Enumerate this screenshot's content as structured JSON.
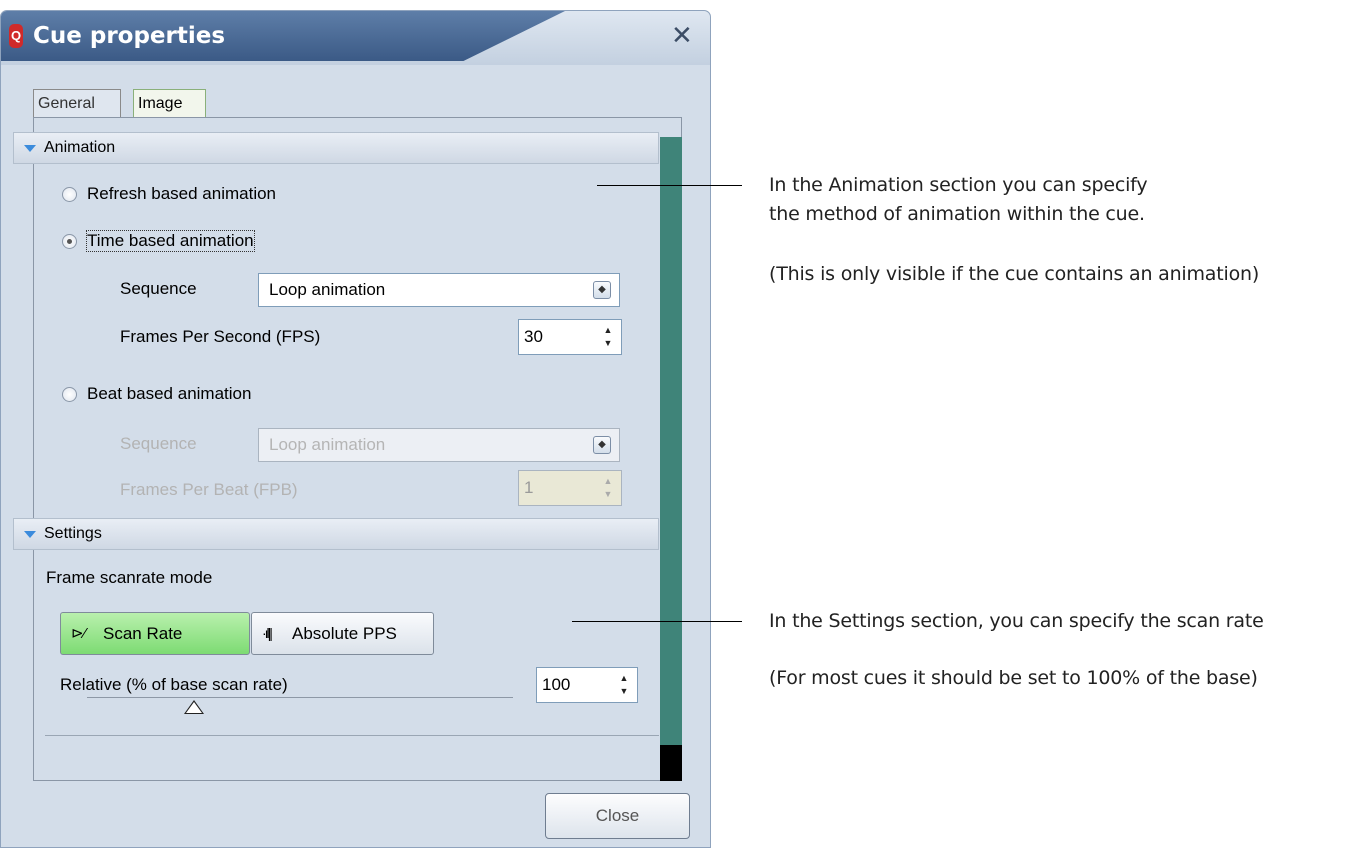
{
  "dialog": {
    "title": "Cue properties",
    "app_icon_letter": "Q",
    "close_symbol": "✕",
    "tabs": [
      {
        "label": "General"
      },
      {
        "label": "Image"
      }
    ],
    "animation": {
      "header": "Animation",
      "refresh_label": "Refresh based animation",
      "time_label": "Time based animation",
      "time_sequence_label": "Sequence",
      "time_sequence_value": "Loop animation",
      "fps_label": "Frames Per Second (FPS)",
      "fps_value": "30",
      "beat_label": "Beat based animation",
      "beat_sequence_label": "Sequence",
      "beat_sequence_value": "Loop animation",
      "fpb_label": "Frames Per Beat (FPB)",
      "fpb_value": "1",
      "selected": "time"
    },
    "settings": {
      "header": "Settings",
      "mode_label": "Frame scanrate mode",
      "scan_rate_button": "Scan Rate",
      "absolute_pps_button": "Absolute PPS",
      "relative_label": "Relative (% of base scan rate)",
      "relative_value": "100",
      "slider_level": 0.25
    },
    "close_button": "Close"
  },
  "notes": {
    "animation_1": "In the Animation section you can specify",
    "animation_2": "the method of animation within the cue.",
    "animation_3": "(This is only visible if the cue contains an animation)",
    "settings_1": "In the Settings section, you can specify the scan rate",
    "settings_2": "(For most cues it should be set to 100% of the base)"
  }
}
